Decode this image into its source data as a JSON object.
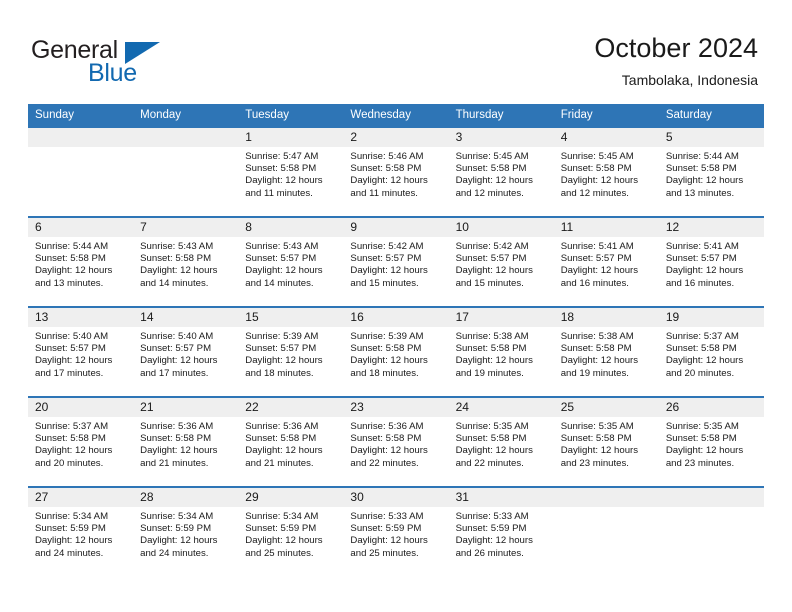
{
  "brand": {
    "name_part1": "General",
    "name_part2": "Blue"
  },
  "header": {
    "title": "October 2024",
    "subtitle": "Tambolaka, Indonesia"
  },
  "colors": {
    "header_blue": "#2e75b6",
    "logo_blue": "#1269b0",
    "daynum_gray": "#efefef"
  },
  "weekdays": [
    "Sunday",
    "Monday",
    "Tuesday",
    "Wednesday",
    "Thursday",
    "Friday",
    "Saturday"
  ],
  "labels": {
    "sunrise": "Sunrise:",
    "sunset": "Sunset:",
    "daylight": "Daylight:"
  },
  "weeks": [
    [
      {
        "day": "",
        "sunrise": "",
        "sunset": "",
        "daylight_1": "",
        "daylight_2": ""
      },
      {
        "day": "",
        "sunrise": "",
        "sunset": "",
        "daylight_1": "",
        "daylight_2": ""
      },
      {
        "day": "1",
        "sunrise": "Sunrise: 5:47 AM",
        "sunset": "Sunset: 5:58 PM",
        "daylight_1": "Daylight: 12 hours",
        "daylight_2": "and 11 minutes."
      },
      {
        "day": "2",
        "sunrise": "Sunrise: 5:46 AM",
        "sunset": "Sunset: 5:58 PM",
        "daylight_1": "Daylight: 12 hours",
        "daylight_2": "and 11 minutes."
      },
      {
        "day": "3",
        "sunrise": "Sunrise: 5:45 AM",
        "sunset": "Sunset: 5:58 PM",
        "daylight_1": "Daylight: 12 hours",
        "daylight_2": "and 12 minutes."
      },
      {
        "day": "4",
        "sunrise": "Sunrise: 5:45 AM",
        "sunset": "Sunset: 5:58 PM",
        "daylight_1": "Daylight: 12 hours",
        "daylight_2": "and 12 minutes."
      },
      {
        "day": "5",
        "sunrise": "Sunrise: 5:44 AM",
        "sunset": "Sunset: 5:58 PM",
        "daylight_1": "Daylight: 12 hours",
        "daylight_2": "and 13 minutes."
      }
    ],
    [
      {
        "day": "6",
        "sunrise": "Sunrise: 5:44 AM",
        "sunset": "Sunset: 5:58 PM",
        "daylight_1": "Daylight: 12 hours",
        "daylight_2": "and 13 minutes."
      },
      {
        "day": "7",
        "sunrise": "Sunrise: 5:43 AM",
        "sunset": "Sunset: 5:58 PM",
        "daylight_1": "Daylight: 12 hours",
        "daylight_2": "and 14 minutes."
      },
      {
        "day": "8",
        "sunrise": "Sunrise: 5:43 AM",
        "sunset": "Sunset: 5:57 PM",
        "daylight_1": "Daylight: 12 hours",
        "daylight_2": "and 14 minutes."
      },
      {
        "day": "9",
        "sunrise": "Sunrise: 5:42 AM",
        "sunset": "Sunset: 5:57 PM",
        "daylight_1": "Daylight: 12 hours",
        "daylight_2": "and 15 minutes."
      },
      {
        "day": "10",
        "sunrise": "Sunrise: 5:42 AM",
        "sunset": "Sunset: 5:57 PM",
        "daylight_1": "Daylight: 12 hours",
        "daylight_2": "and 15 minutes."
      },
      {
        "day": "11",
        "sunrise": "Sunrise: 5:41 AM",
        "sunset": "Sunset: 5:57 PM",
        "daylight_1": "Daylight: 12 hours",
        "daylight_2": "and 16 minutes."
      },
      {
        "day": "12",
        "sunrise": "Sunrise: 5:41 AM",
        "sunset": "Sunset: 5:57 PM",
        "daylight_1": "Daylight: 12 hours",
        "daylight_2": "and 16 minutes."
      }
    ],
    [
      {
        "day": "13",
        "sunrise": "Sunrise: 5:40 AM",
        "sunset": "Sunset: 5:57 PM",
        "daylight_1": "Daylight: 12 hours",
        "daylight_2": "and 17 minutes."
      },
      {
        "day": "14",
        "sunrise": "Sunrise: 5:40 AM",
        "sunset": "Sunset: 5:57 PM",
        "daylight_1": "Daylight: 12 hours",
        "daylight_2": "and 17 minutes."
      },
      {
        "day": "15",
        "sunrise": "Sunrise: 5:39 AM",
        "sunset": "Sunset: 5:57 PM",
        "daylight_1": "Daylight: 12 hours",
        "daylight_2": "and 18 minutes."
      },
      {
        "day": "16",
        "sunrise": "Sunrise: 5:39 AM",
        "sunset": "Sunset: 5:58 PM",
        "daylight_1": "Daylight: 12 hours",
        "daylight_2": "and 18 minutes."
      },
      {
        "day": "17",
        "sunrise": "Sunrise: 5:38 AM",
        "sunset": "Sunset: 5:58 PM",
        "daylight_1": "Daylight: 12 hours",
        "daylight_2": "and 19 minutes."
      },
      {
        "day": "18",
        "sunrise": "Sunrise: 5:38 AM",
        "sunset": "Sunset: 5:58 PM",
        "daylight_1": "Daylight: 12 hours",
        "daylight_2": "and 19 minutes."
      },
      {
        "day": "19",
        "sunrise": "Sunrise: 5:37 AM",
        "sunset": "Sunset: 5:58 PM",
        "daylight_1": "Daylight: 12 hours",
        "daylight_2": "and 20 minutes."
      }
    ],
    [
      {
        "day": "20",
        "sunrise": "Sunrise: 5:37 AM",
        "sunset": "Sunset: 5:58 PM",
        "daylight_1": "Daylight: 12 hours",
        "daylight_2": "and 20 minutes."
      },
      {
        "day": "21",
        "sunrise": "Sunrise: 5:36 AM",
        "sunset": "Sunset: 5:58 PM",
        "daylight_1": "Daylight: 12 hours",
        "daylight_2": "and 21 minutes."
      },
      {
        "day": "22",
        "sunrise": "Sunrise: 5:36 AM",
        "sunset": "Sunset: 5:58 PM",
        "daylight_1": "Daylight: 12 hours",
        "daylight_2": "and 21 minutes."
      },
      {
        "day": "23",
        "sunrise": "Sunrise: 5:36 AM",
        "sunset": "Sunset: 5:58 PM",
        "daylight_1": "Daylight: 12 hours",
        "daylight_2": "and 22 minutes."
      },
      {
        "day": "24",
        "sunrise": "Sunrise: 5:35 AM",
        "sunset": "Sunset: 5:58 PM",
        "daylight_1": "Daylight: 12 hours",
        "daylight_2": "and 22 minutes."
      },
      {
        "day": "25",
        "sunrise": "Sunrise: 5:35 AM",
        "sunset": "Sunset: 5:58 PM",
        "daylight_1": "Daylight: 12 hours",
        "daylight_2": "and 23 minutes."
      },
      {
        "day": "26",
        "sunrise": "Sunrise: 5:35 AM",
        "sunset": "Sunset: 5:58 PM",
        "daylight_1": "Daylight: 12 hours",
        "daylight_2": "and 23 minutes."
      }
    ],
    [
      {
        "day": "27",
        "sunrise": "Sunrise: 5:34 AM",
        "sunset": "Sunset: 5:59 PM",
        "daylight_1": "Daylight: 12 hours",
        "daylight_2": "and 24 minutes."
      },
      {
        "day": "28",
        "sunrise": "Sunrise: 5:34 AM",
        "sunset": "Sunset: 5:59 PM",
        "daylight_1": "Daylight: 12 hours",
        "daylight_2": "and 24 minutes."
      },
      {
        "day": "29",
        "sunrise": "Sunrise: 5:34 AM",
        "sunset": "Sunset: 5:59 PM",
        "daylight_1": "Daylight: 12 hours",
        "daylight_2": "and 25 minutes."
      },
      {
        "day": "30",
        "sunrise": "Sunrise: 5:33 AM",
        "sunset": "Sunset: 5:59 PM",
        "daylight_1": "Daylight: 12 hours",
        "daylight_2": "and 25 minutes."
      },
      {
        "day": "31",
        "sunrise": "Sunrise: 5:33 AM",
        "sunset": "Sunset: 5:59 PM",
        "daylight_1": "Daylight: 12 hours",
        "daylight_2": "and 26 minutes."
      },
      {
        "day": "",
        "sunrise": "",
        "sunset": "",
        "daylight_1": "",
        "daylight_2": ""
      },
      {
        "day": "",
        "sunrise": "",
        "sunset": "",
        "daylight_1": "",
        "daylight_2": ""
      }
    ]
  ]
}
